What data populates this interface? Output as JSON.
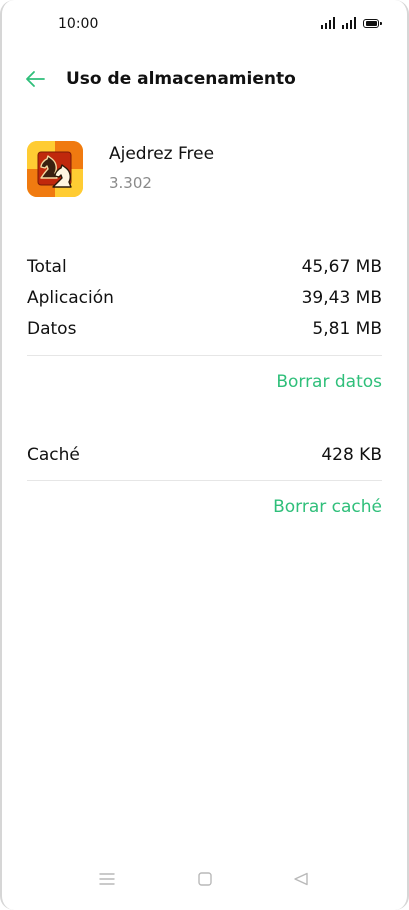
{
  "status_bar": {
    "time": "10:00"
  },
  "header": {
    "title": "Uso de almacenamiento"
  },
  "app": {
    "name": "Ajedrez Free",
    "version": "3.302"
  },
  "storage": {
    "rows": [
      {
        "label": "Total",
        "value": "45,67 MB"
      },
      {
        "label": "Aplicación",
        "value": "39,43 MB"
      },
      {
        "label": "Datos",
        "value": "5,81 MB"
      }
    ],
    "clear_data_label": "Borrar datos"
  },
  "cache": {
    "label": "Caché",
    "value": "428 KB",
    "clear_cache_label": "Borrar caché"
  },
  "colors": {
    "accent": "#2fbf7a",
    "text": "#111111",
    "secondary": "#8a8a8a",
    "divider": "#e6e6e6"
  }
}
